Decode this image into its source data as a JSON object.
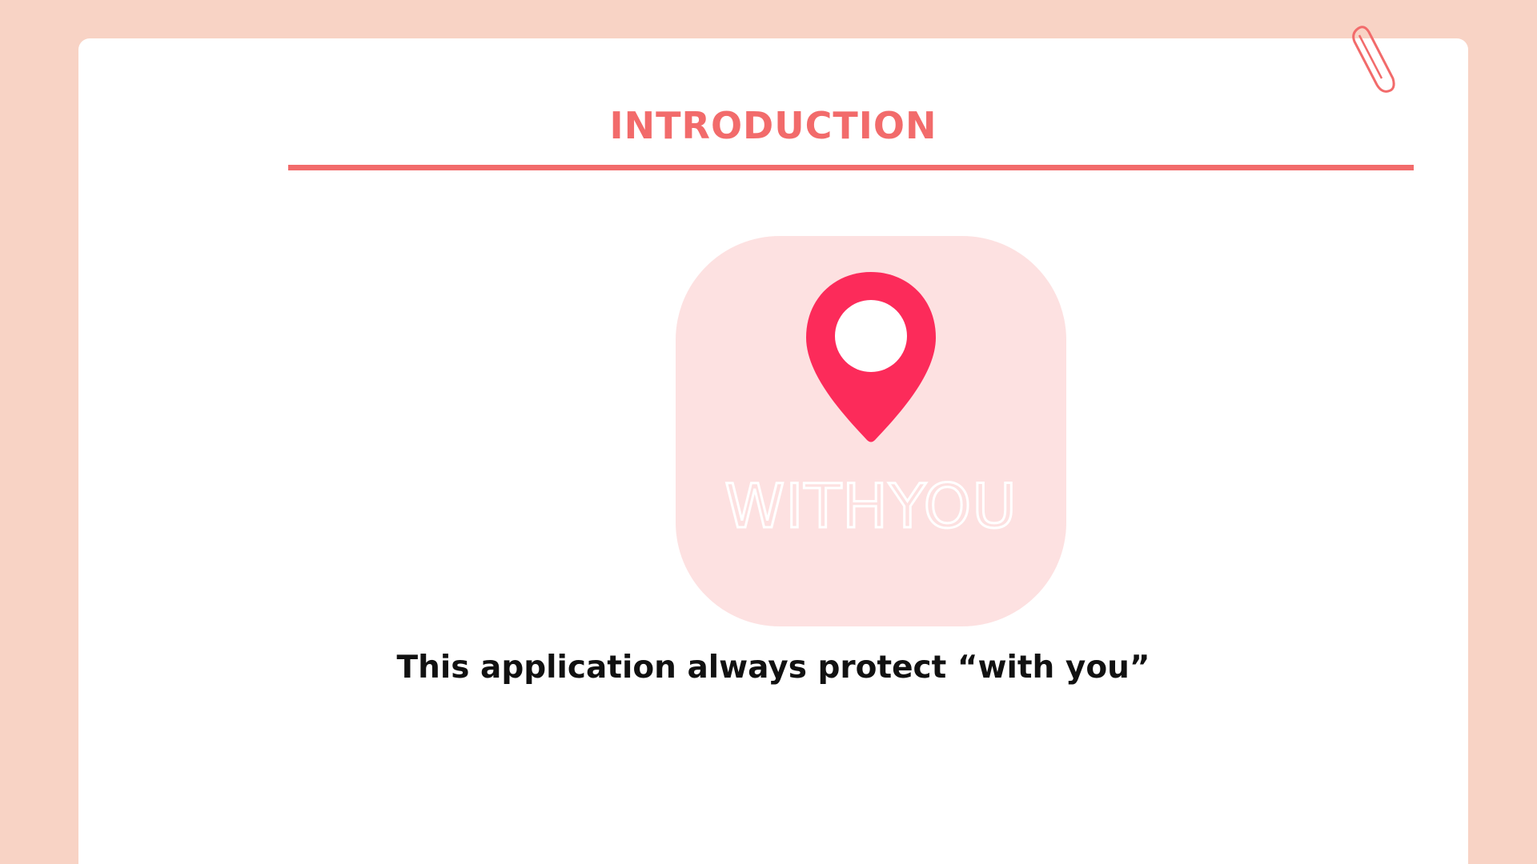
{
  "slide": {
    "title": "INTRODUCTION",
    "tagline": "This application always protect “with you”"
  },
  "app_icon": {
    "wordmark": "WITHYOU",
    "icon": "map-pin-icon"
  },
  "decoration": {
    "icon": "paperclip-icon"
  },
  "colors": {
    "background": "#f8d3c5",
    "card": "#ffffff",
    "accent": "#f26b6b",
    "icon_tile": "#fde1e1",
    "pin": "#fc2b5a",
    "text": "#111111"
  }
}
